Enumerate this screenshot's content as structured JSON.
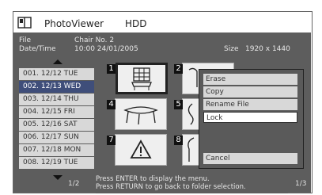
{
  "header": {
    "app_title": "PhotoViewer",
    "media": "HDD"
  },
  "info": {
    "file_label": "File",
    "file_value": "Chair No. 2",
    "datetime_label": "Date/Time",
    "datetime_value": "10:00 24/01/2005",
    "size_label": "Size",
    "size_value": "1920 x 1440"
  },
  "folders": [
    {
      "label": "001. 12/12 TUE"
    },
    {
      "label": "002. 12/13 WED",
      "selected": true
    },
    {
      "label": "003. 12/14 THU"
    },
    {
      "label": "004. 12/15 FRI"
    },
    {
      "label": "005. 12/16 SAT"
    },
    {
      "label": "006. 12/17 SUN"
    },
    {
      "label": "007. 12/18 MON"
    },
    {
      "label": "008. 12/19 TUE"
    }
  ],
  "folder_page": "1/2",
  "thumbs": [
    {
      "num": "1",
      "icon": "chair-icon",
      "selected": true
    },
    {
      "num": "2",
      "icon": "chair-icon"
    },
    {
      "num": "4",
      "icon": "table-icon"
    },
    {
      "num": "5",
      "icon": "chair-icon"
    },
    {
      "num": "7",
      "icon": "warning-icon"
    },
    {
      "num": "8",
      "icon": "chair-icon"
    }
  ],
  "menu": {
    "items": [
      "Erase",
      "Copy",
      "Rename File",
      "Lock"
    ],
    "selected": "Lock",
    "cancel": "Cancel"
  },
  "status": {
    "line1": "Press ENTER to display the menu.",
    "line2": "Press RETURN to go back to folder selection."
  },
  "thumb_page": "1/3"
}
